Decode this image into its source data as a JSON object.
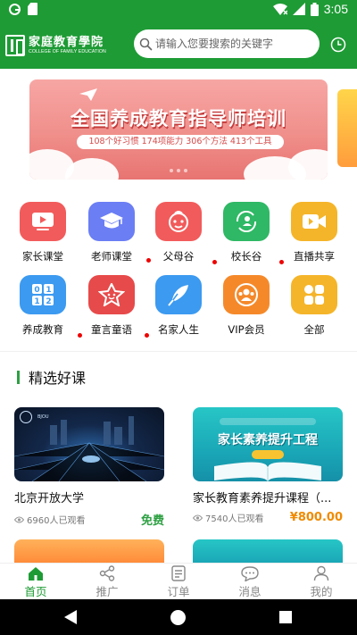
{
  "status_bar": {
    "time": "3:05"
  },
  "header": {
    "logo_cn": "家庭教育學院",
    "logo_en": "COLLEGE OF FAMILY EDUCATION",
    "search_placeholder": "请输入您要搜索的关键字",
    "brand_color": "#1e9b35"
  },
  "banner": {
    "title": "全国养成教育指导师培训",
    "subtitle": "108个好习惯 174项能力 306个方法 413个工具"
  },
  "categories": [
    {
      "label": "家长课堂",
      "icon": "video-play-icon",
      "color": "#f25b5b",
      "dot": false
    },
    {
      "label": "老师课堂",
      "icon": "graduation-cap-icon",
      "color": "#6b7ef4",
      "dot": true
    },
    {
      "label": "父母谷",
      "icon": "baby-face-icon",
      "color": "#f25b5b",
      "dot": true
    },
    {
      "label": "校长谷",
      "icon": "principal-icon",
      "color": "#2fb865",
      "dot": true
    },
    {
      "label": "直播共享",
      "icon": "live-camera-icon",
      "color": "#f5b52a",
      "dot": false
    },
    {
      "label": "养成教育",
      "icon": "number-blocks-icon",
      "color": "#3c9af0",
      "dot": true
    },
    {
      "label": "童言童语",
      "icon": "star-face-icon",
      "color": "#e74a4a",
      "dot": true
    },
    {
      "label": "名家人生",
      "icon": "quill-icon",
      "color": "#3c9af0",
      "dot": false
    },
    {
      "label": "VIP会员",
      "icon": "vip-people-icon",
      "color": "#f5892a",
      "dot": false
    },
    {
      "label": "全部",
      "icon": "all-apps-icon",
      "color": "#f5b52a",
      "dot": false
    }
  ],
  "section": {
    "title": "精选好课"
  },
  "courses": [
    {
      "title": "北京开放大学",
      "views": "6960人已观看",
      "price": "免费",
      "price_color": "#2ea043"
    },
    {
      "title": "家长教育素养提升课程（...",
      "views": "7540人已观看",
      "price": "¥800.00",
      "price_color": "#f08a00",
      "thumb_text": "家长素养提升工程"
    }
  ],
  "tabs": [
    {
      "label": "首页",
      "icon": "home-icon",
      "active": true
    },
    {
      "label": "推广",
      "icon": "share-icon",
      "active": false
    },
    {
      "label": "订单",
      "icon": "order-icon",
      "active": false
    },
    {
      "label": "消息",
      "icon": "message-icon",
      "active": false
    },
    {
      "label": "我的",
      "icon": "profile-icon",
      "active": false
    }
  ]
}
